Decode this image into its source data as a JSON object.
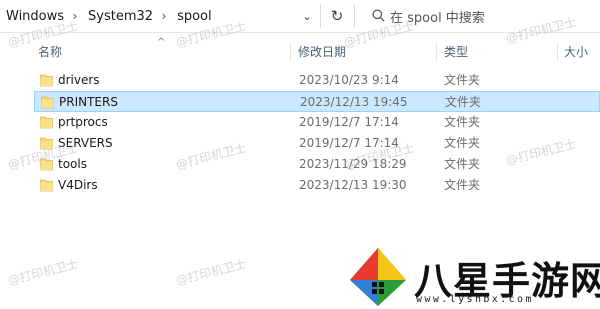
{
  "address": {
    "breadcrumbs": [
      "Windows",
      "System32",
      "spool"
    ],
    "search_placeholder": "在 spool 中搜索"
  },
  "columns": {
    "name": "名称",
    "modified": "修改日期",
    "type": "类型",
    "size": "大小"
  },
  "files": [
    {
      "name": "drivers",
      "modified": "2023/10/23 9:14",
      "type": "文件夹",
      "selected": false
    },
    {
      "name": "PRINTERS",
      "modified": "2023/12/13 19:45",
      "type": "文件夹",
      "selected": true
    },
    {
      "name": "prtprocs",
      "modified": "2019/12/7 17:14",
      "type": "文件夹",
      "selected": false
    },
    {
      "name": "SERVERS",
      "modified": "2019/12/7 17:14",
      "type": "文件夹",
      "selected": false
    },
    {
      "name": "tools",
      "modified": "2023/11/29 18:29",
      "type": "文件夹",
      "selected": false
    },
    {
      "name": "V4Dirs",
      "modified": "2023/12/13 19:30",
      "type": "文件夹",
      "selected": false
    }
  ],
  "watermark": "@打印机卫士",
  "logo": {
    "text": "八星手游网",
    "url": "www.lyshbx.com"
  },
  "colors": {
    "selection_bg": "#cce8ff",
    "selection_border": "#99d1ff",
    "folder": "#f8d775",
    "header_text": "#4c607a"
  }
}
